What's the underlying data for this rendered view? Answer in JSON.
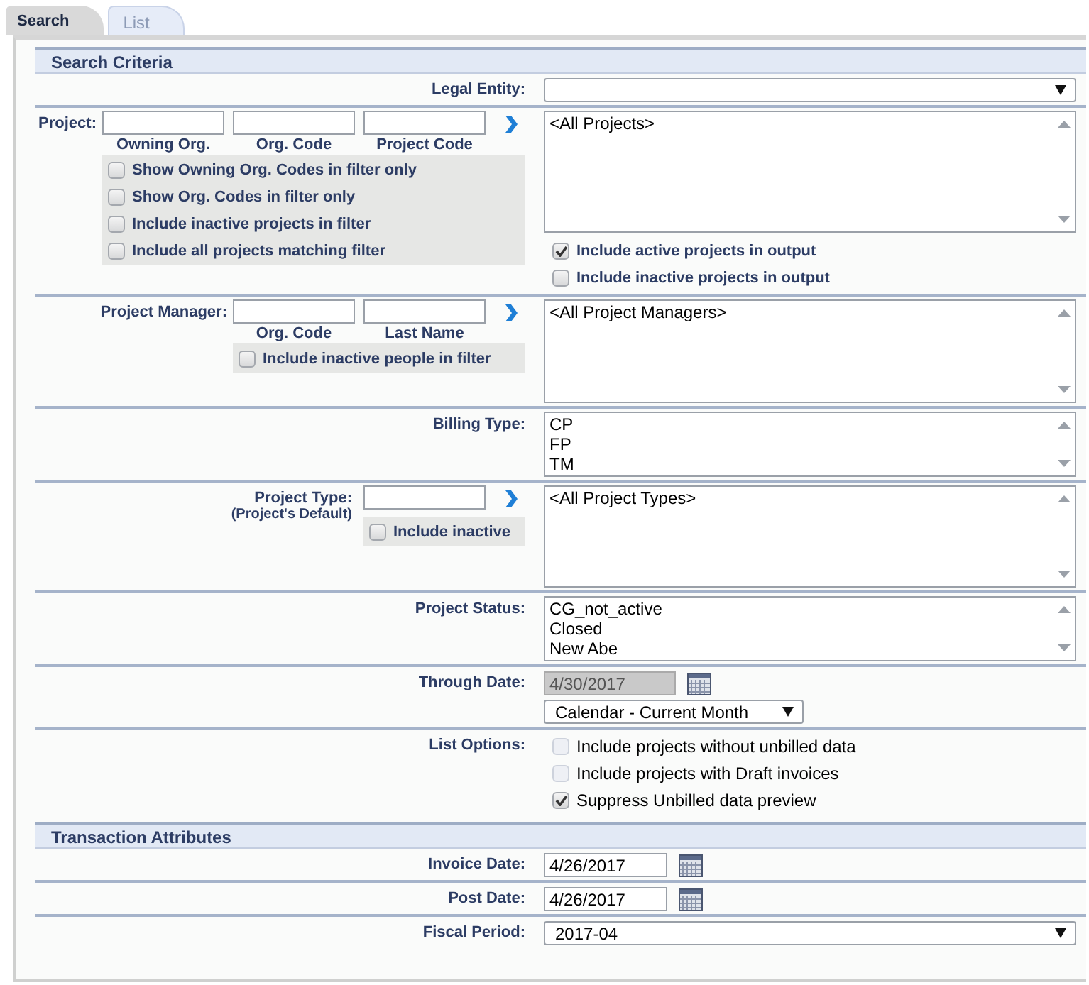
{
  "tabs": [
    {
      "label": "Search",
      "selected": true
    },
    {
      "label": "List",
      "selected": false
    }
  ],
  "sections": [
    {
      "title": "Search Criteria",
      "rows": [
        {
          "kind": "select",
          "label": "Legal Entity:"
        },
        {
          "kind": "filter",
          "label": "Project:",
          "fields": [
            {
              "kind": "text_input",
              "caption": "Owning Org."
            },
            {
              "kind": "text_input",
              "caption": "Org. Code"
            },
            {
              "kind": "text_input",
              "caption": "Project Code"
            }
          ],
          "filter_options": [
            {
              "label": "Show Owning Org. Codes in filter only",
              "checked": false
            },
            {
              "label": "Show Org. Codes in filter only",
              "checked": false
            },
            {
              "label": "Include inactive projects in filter",
              "checked": false
            },
            {
              "label": "Include all projects matching filter",
              "checked": false
            }
          ],
          "items": [
            "<All Projects>"
          ],
          "output_options": [
            {
              "label": "Include active projects in output",
              "checked": true
            },
            {
              "label": "Include inactive projects in output",
              "checked": false
            }
          ]
        },
        {
          "kind": "filter",
          "label": "Project Manager:",
          "fields": [
            {
              "kind": "text_input",
              "caption": "Org. Code"
            },
            {
              "kind": "text_input",
              "caption": "Last Name"
            }
          ],
          "filter_options": [
            {
              "label": "Include inactive people in filter",
              "checked": false
            }
          ],
          "items": [
            "<All Project Managers>"
          ]
        },
        {
          "kind": "listbox",
          "label": "Billing Type:",
          "items": [
            "CP",
            "FP",
            "TM"
          ]
        },
        {
          "kind": "filter",
          "label": "Project Type:",
          "sublabel": "(Project's Default)",
          "fields": [
            {
              "kind": "text_input"
            }
          ],
          "filter_options": [
            {
              "label": "Include inactive",
              "checked": false
            }
          ],
          "items": [
            "<All Project Types>"
          ]
        },
        {
          "kind": "listbox",
          "label": "Project Status:",
          "items": [
            "CG_not_active",
            "Closed",
            "New Abe"
          ]
        },
        {
          "kind": "date_period",
          "label": "Through Date:",
          "date": "4/30/2017",
          "date_disabled": true,
          "period": "Calendar - Current Month"
        },
        {
          "kind": "checks",
          "label": "List Options:",
          "options": [
            {
              "label": "Include projects without unbilled data",
              "checked": false,
              "disabled": true
            },
            {
              "label": "Include projects with Draft invoices",
              "checked": false,
              "disabled": true
            },
            {
              "label": "Suppress Unbilled data preview",
              "checked": true,
              "disabled": false
            }
          ]
        }
      ]
    },
    {
      "title": "Transaction Attributes",
      "rows": [
        {
          "kind": "date",
          "label": "Invoice Date:",
          "value": "4/26/2017"
        },
        {
          "kind": "date",
          "label": "Post Date:",
          "value": "4/26/2017"
        },
        {
          "kind": "select",
          "label": "Fiscal Period:",
          "value": "2017-04"
        }
      ]
    }
  ]
}
